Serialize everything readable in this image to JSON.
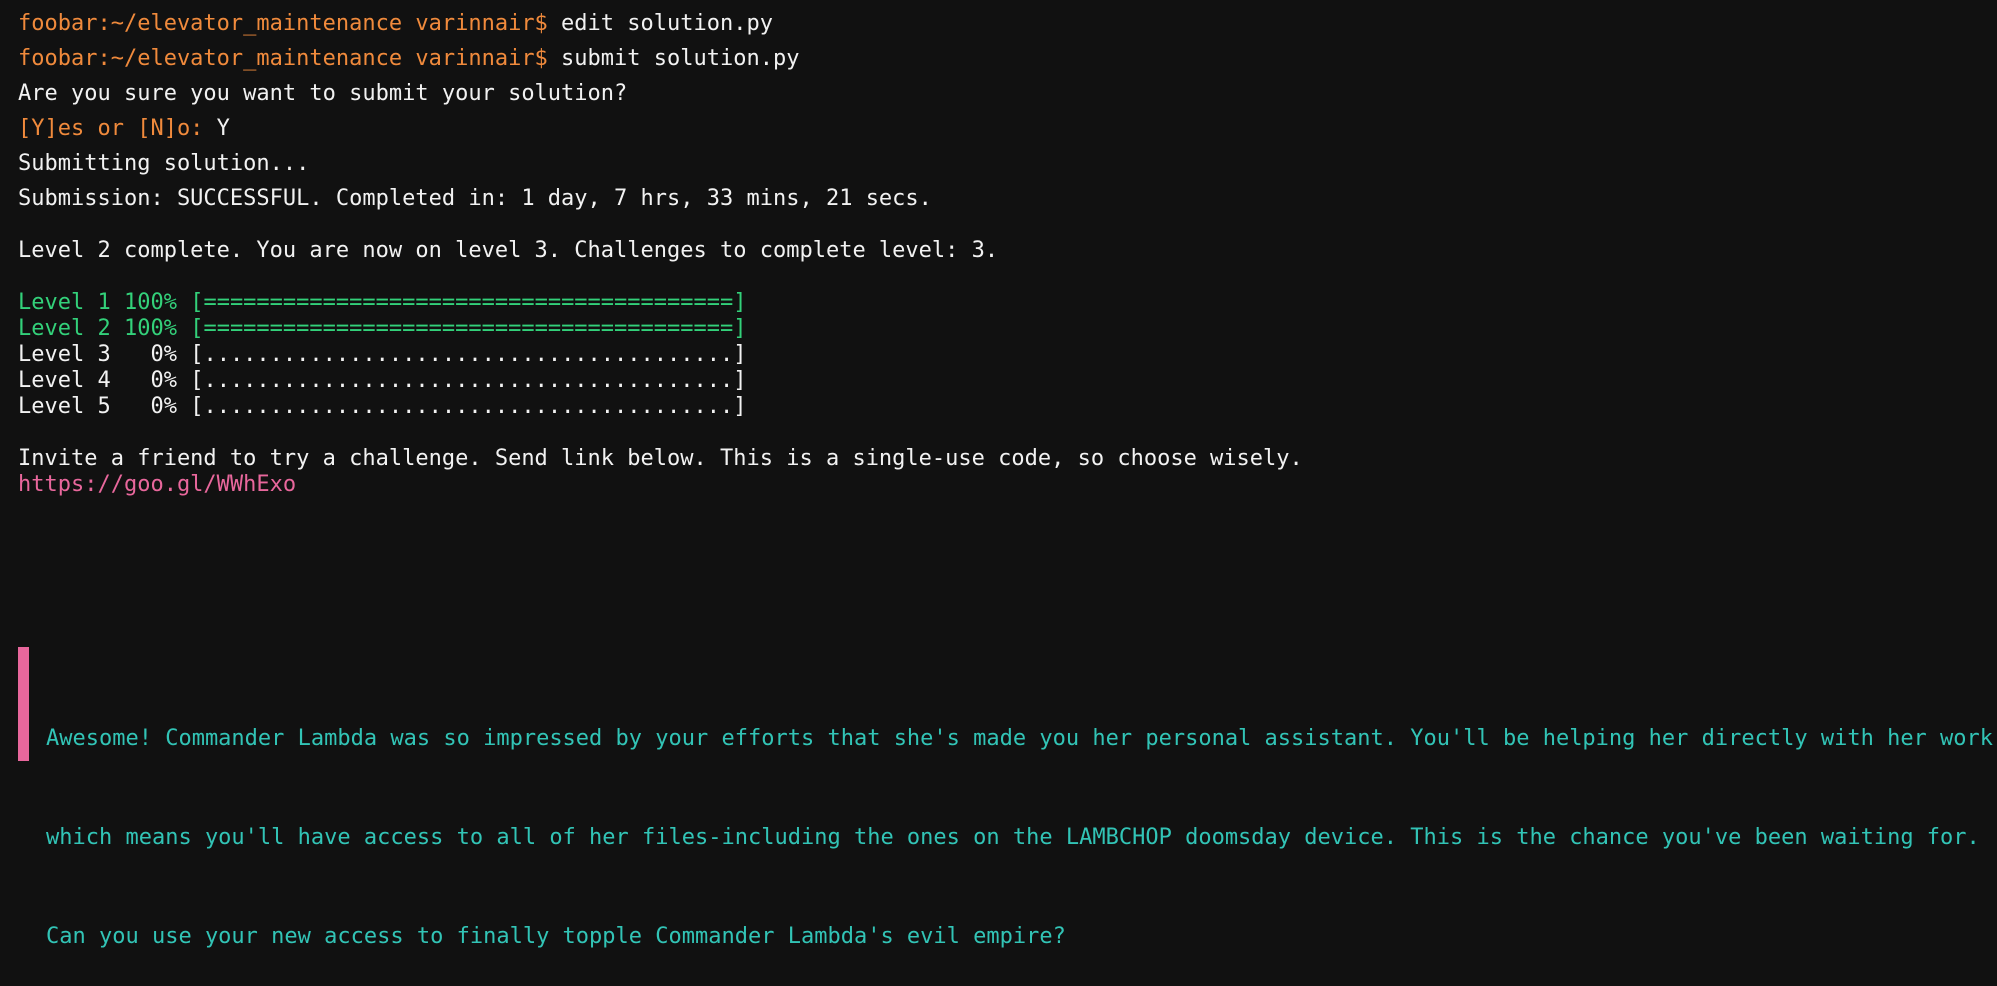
{
  "session": [
    {
      "prompt": "foobar:~/elevator_maintenance varinnair$",
      "command": " edit solution.py"
    },
    {
      "prompt": "foobar:~/elevator_maintenance varinnair$",
      "command": " submit solution.py"
    }
  ],
  "confirm_question": "Are you sure you want to submit your solution?",
  "confirm_prompt": "[Y]es or [N]o:",
  "confirm_answer": " Y",
  "submitting": "Submitting solution...",
  "submission_result": "Submission: SUCCESSFUL. Completed in: 1 day, 7 hrs, 33 mins, 21 secs.",
  "level_message": "Level 2 complete. You are now on level 3. Challenges to complete level: 3.",
  "levels": [
    {
      "label": "Level 1 100%",
      "bar": "[========================================]",
      "progress": 1.0,
      "color": "green"
    },
    {
      "label": "Level 2 100%",
      "bar": "[========================================]",
      "progress": 1.0,
      "color": "green"
    },
    {
      "label": "Level 3   0%",
      "bar": "[........................................]",
      "progress": 0.0,
      "color": "white"
    },
    {
      "label": "Level 4   0%",
      "bar": "[........................................]",
      "progress": 0.0,
      "color": "white"
    },
    {
      "label": "Level 5   0%",
      "bar": "[........................................]",
      "progress": 0.0,
      "color": "white"
    }
  ],
  "invite_text": "Invite a friend to try a challenge. Send link below. This is a single-use code, so choose wisely.",
  "invite_link": "https://goo.gl/WWhExo",
  "story": [
    "Awesome! Commander Lambda was so impressed by your efforts that she's made you her personal assistant. You'll be helping her directly with her work,",
    "which means you'll have access to all of her files-including the ones on the LAMBCHOP doomsday device. This is the chance you've been waiting for.",
    "Can you use your new access to finally topple Commander Lambda's evil empire?"
  ],
  "colors": {
    "background": "#111111",
    "prompt": "#f08a3c",
    "complete": "#33d17a",
    "link": "#e8679c",
    "story": "#32c4b6",
    "text": "#f2f2f2"
  }
}
